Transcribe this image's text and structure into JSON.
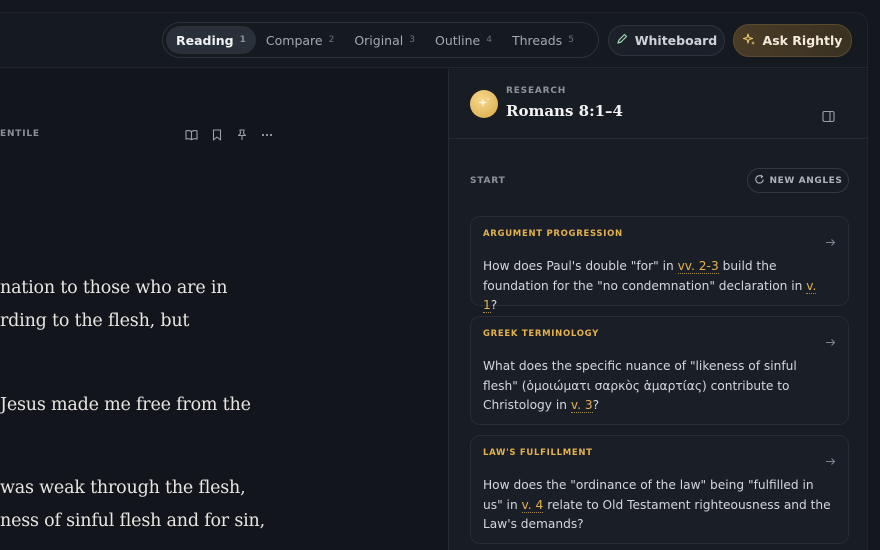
{
  "tabs": [
    {
      "label": "Reading",
      "num": "1"
    },
    {
      "label": "Compare",
      "num": "2"
    },
    {
      "label": "Original",
      "num": "3"
    },
    {
      "label": "Outline",
      "num": "4"
    },
    {
      "label": "Threads",
      "num": "5"
    }
  ],
  "header": {
    "whiteboard_label": "Whiteboard",
    "ask_label": "Ask Rightly"
  },
  "reader": {
    "label": "ENTILE",
    "lines": [
      "nation to those who are in",
      "rding to the flesh, but",
      "Jesus made me free from the",
      "was weak through the flesh,",
      "ness of sinful flesh and for sin,"
    ]
  },
  "panel": {
    "eyebrow": "RESEARCH",
    "title": "Romans 8:1–4",
    "start_label": "START",
    "new_angles_label": "NEW ANGLES",
    "cards": [
      {
        "category": "ARGUMENT PROGRESSION",
        "q1": "How does Paul's double \"for\" in ",
        "ref1": "vv. 2-3",
        "q2": " build the foundation for the \"no condemnation\" declaration in ",
        "ref2": "v. 1",
        "q3": "?"
      },
      {
        "category": "GREEK TERMINOLOGY",
        "q1": "What does the specific nuance of \"likeness of sinful flesh\" (ὁμοιώματι σαρκὸς ἁμαρτίας) contribute to Christology in ",
        "ref1": "v. 3",
        "q2": "?"
      },
      {
        "category": "LAW'S FULFILLMENT",
        "q1": "How does the \"ordinance of the law\" being \"fulfilled in us\" in ",
        "ref1": "v. 4",
        "q2": " relate to Old Testament righteousness and the Law's demands?"
      }
    ]
  },
  "colors": {
    "accent": "#e3b24f",
    "background": "#151920",
    "panel": "#181c23"
  }
}
